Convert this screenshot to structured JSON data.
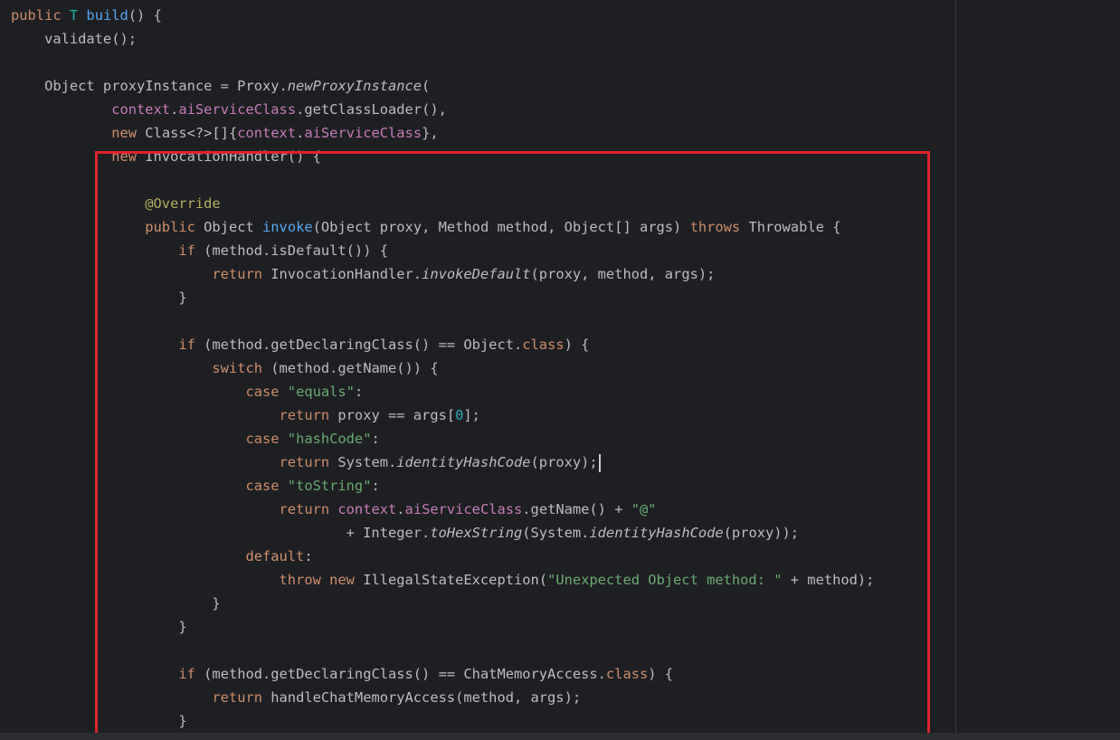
{
  "editor": {
    "lines": [
      [
        [
          "kw",
          "public "
        ],
        [
          "type",
          "T "
        ],
        [
          "fn",
          "build"
        ],
        [
          "plain",
          "() {"
        ]
      ],
      [
        [
          "plain",
          "    validate();"
        ]
      ],
      [],
      [
        [
          "plain",
          "    Object proxyInstance = Proxy."
        ],
        [
          "it",
          "newProxyInstance"
        ],
        [
          "plain",
          "("
        ]
      ],
      [
        [
          "plain",
          "            "
        ],
        [
          "field",
          "context"
        ],
        [
          "plain",
          "."
        ],
        [
          "field",
          "aiServiceClass"
        ],
        [
          "plain",
          ".getClassLoader(),"
        ]
      ],
      [
        [
          "plain",
          "            "
        ],
        [
          "kw",
          "new "
        ],
        [
          "plain",
          "Class<?>[]{"
        ],
        [
          "field",
          "context"
        ],
        [
          "plain",
          "."
        ],
        [
          "field",
          "aiServiceClass"
        ],
        [
          "plain",
          "},"
        ]
      ],
      [
        [
          "plain",
          "            "
        ],
        [
          "kw",
          "new "
        ],
        [
          "plain",
          "InvocationHandler() {"
        ]
      ],
      [],
      [
        [
          "plain",
          "                "
        ],
        [
          "ann",
          "@Override"
        ]
      ],
      [
        [
          "plain",
          "                "
        ],
        [
          "kw",
          "public "
        ],
        [
          "plain",
          "Object "
        ],
        [
          "fn",
          "invoke"
        ],
        [
          "plain",
          "(Object proxy, Method method, Object[] args) "
        ],
        [
          "kw",
          "throws "
        ],
        [
          "plain",
          "Throwable {"
        ]
      ],
      [
        [
          "plain",
          "                    "
        ],
        [
          "kw",
          "if "
        ],
        [
          "plain",
          "(method.isDefault()) {"
        ]
      ],
      [
        [
          "plain",
          "                        "
        ],
        [
          "kw",
          "return "
        ],
        [
          "plain",
          "InvocationHandler."
        ],
        [
          "it",
          "invokeDefault"
        ],
        [
          "plain",
          "(proxy, method, args);"
        ]
      ],
      [
        [
          "plain",
          "                    }"
        ]
      ],
      [],
      [
        [
          "plain",
          "                    "
        ],
        [
          "kw",
          "if "
        ],
        [
          "plain",
          "(method.getDeclaringClass() == Object."
        ],
        [
          "kw",
          "class"
        ],
        [
          "plain",
          ") {"
        ]
      ],
      [
        [
          "plain",
          "                        "
        ],
        [
          "kw",
          "switch "
        ],
        [
          "plain",
          "(method.getName()) {"
        ]
      ],
      [
        [
          "plain",
          "                            "
        ],
        [
          "kw",
          "case "
        ],
        [
          "str",
          "\"equals\""
        ],
        [
          "plain",
          ":"
        ]
      ],
      [
        [
          "plain",
          "                                "
        ],
        [
          "kw",
          "return "
        ],
        [
          "plain",
          "proxy == args["
        ],
        [
          "num",
          "0"
        ],
        [
          "plain",
          "];"
        ]
      ],
      [
        [
          "plain",
          "                            "
        ],
        [
          "kw",
          "case "
        ],
        [
          "str",
          "\"hashCode\""
        ],
        [
          "plain",
          ":"
        ]
      ],
      [
        [
          "plain",
          "                                "
        ],
        [
          "kw",
          "return "
        ],
        [
          "plain",
          "System."
        ],
        [
          "it",
          "identityHashCode"
        ],
        [
          "plain",
          "(proxy);"
        ]
      ],
      [
        [
          "plain",
          "                            "
        ],
        [
          "kw",
          "case "
        ],
        [
          "str",
          "\"toString\""
        ],
        [
          "plain",
          ":"
        ]
      ],
      [
        [
          "plain",
          "                                "
        ],
        [
          "kw",
          "return "
        ],
        [
          "field",
          "context"
        ],
        [
          "plain",
          "."
        ],
        [
          "field",
          "aiServiceClass"
        ],
        [
          "plain",
          ".getName() + "
        ],
        [
          "str",
          "\"@\""
        ]
      ],
      [
        [
          "plain",
          "                                        + Integer."
        ],
        [
          "it",
          "toHexString"
        ],
        [
          "plain",
          "(System."
        ],
        [
          "it",
          "identityHashCode"
        ],
        [
          "plain",
          "(proxy));"
        ]
      ],
      [
        [
          "plain",
          "                            "
        ],
        [
          "kw",
          "default"
        ],
        [
          "plain",
          ":"
        ]
      ],
      [
        [
          "plain",
          "                                "
        ],
        [
          "kw",
          "throw new "
        ],
        [
          "plain",
          "IllegalStateException("
        ],
        [
          "str",
          "\"Unexpected Object method: \""
        ],
        [
          "plain",
          " + method);"
        ]
      ],
      [
        [
          "plain",
          "                        }"
        ]
      ],
      [
        [
          "plain",
          "                    }"
        ]
      ],
      [],
      [
        [
          "plain",
          "                    "
        ],
        [
          "kw",
          "if "
        ],
        [
          "plain",
          "(method.getDeclaringClass() == ChatMemoryAccess."
        ],
        [
          "kw",
          "class"
        ],
        [
          "plain",
          ") {"
        ]
      ],
      [
        [
          "plain",
          "                        "
        ],
        [
          "kw",
          "return "
        ],
        [
          "plain",
          "handleChatMemoryAccess(method, args);"
        ]
      ],
      [
        [
          "plain",
          "                    }"
        ]
      ]
    ],
    "current_line": 19,
    "highlight_color": "#e0232b"
  }
}
